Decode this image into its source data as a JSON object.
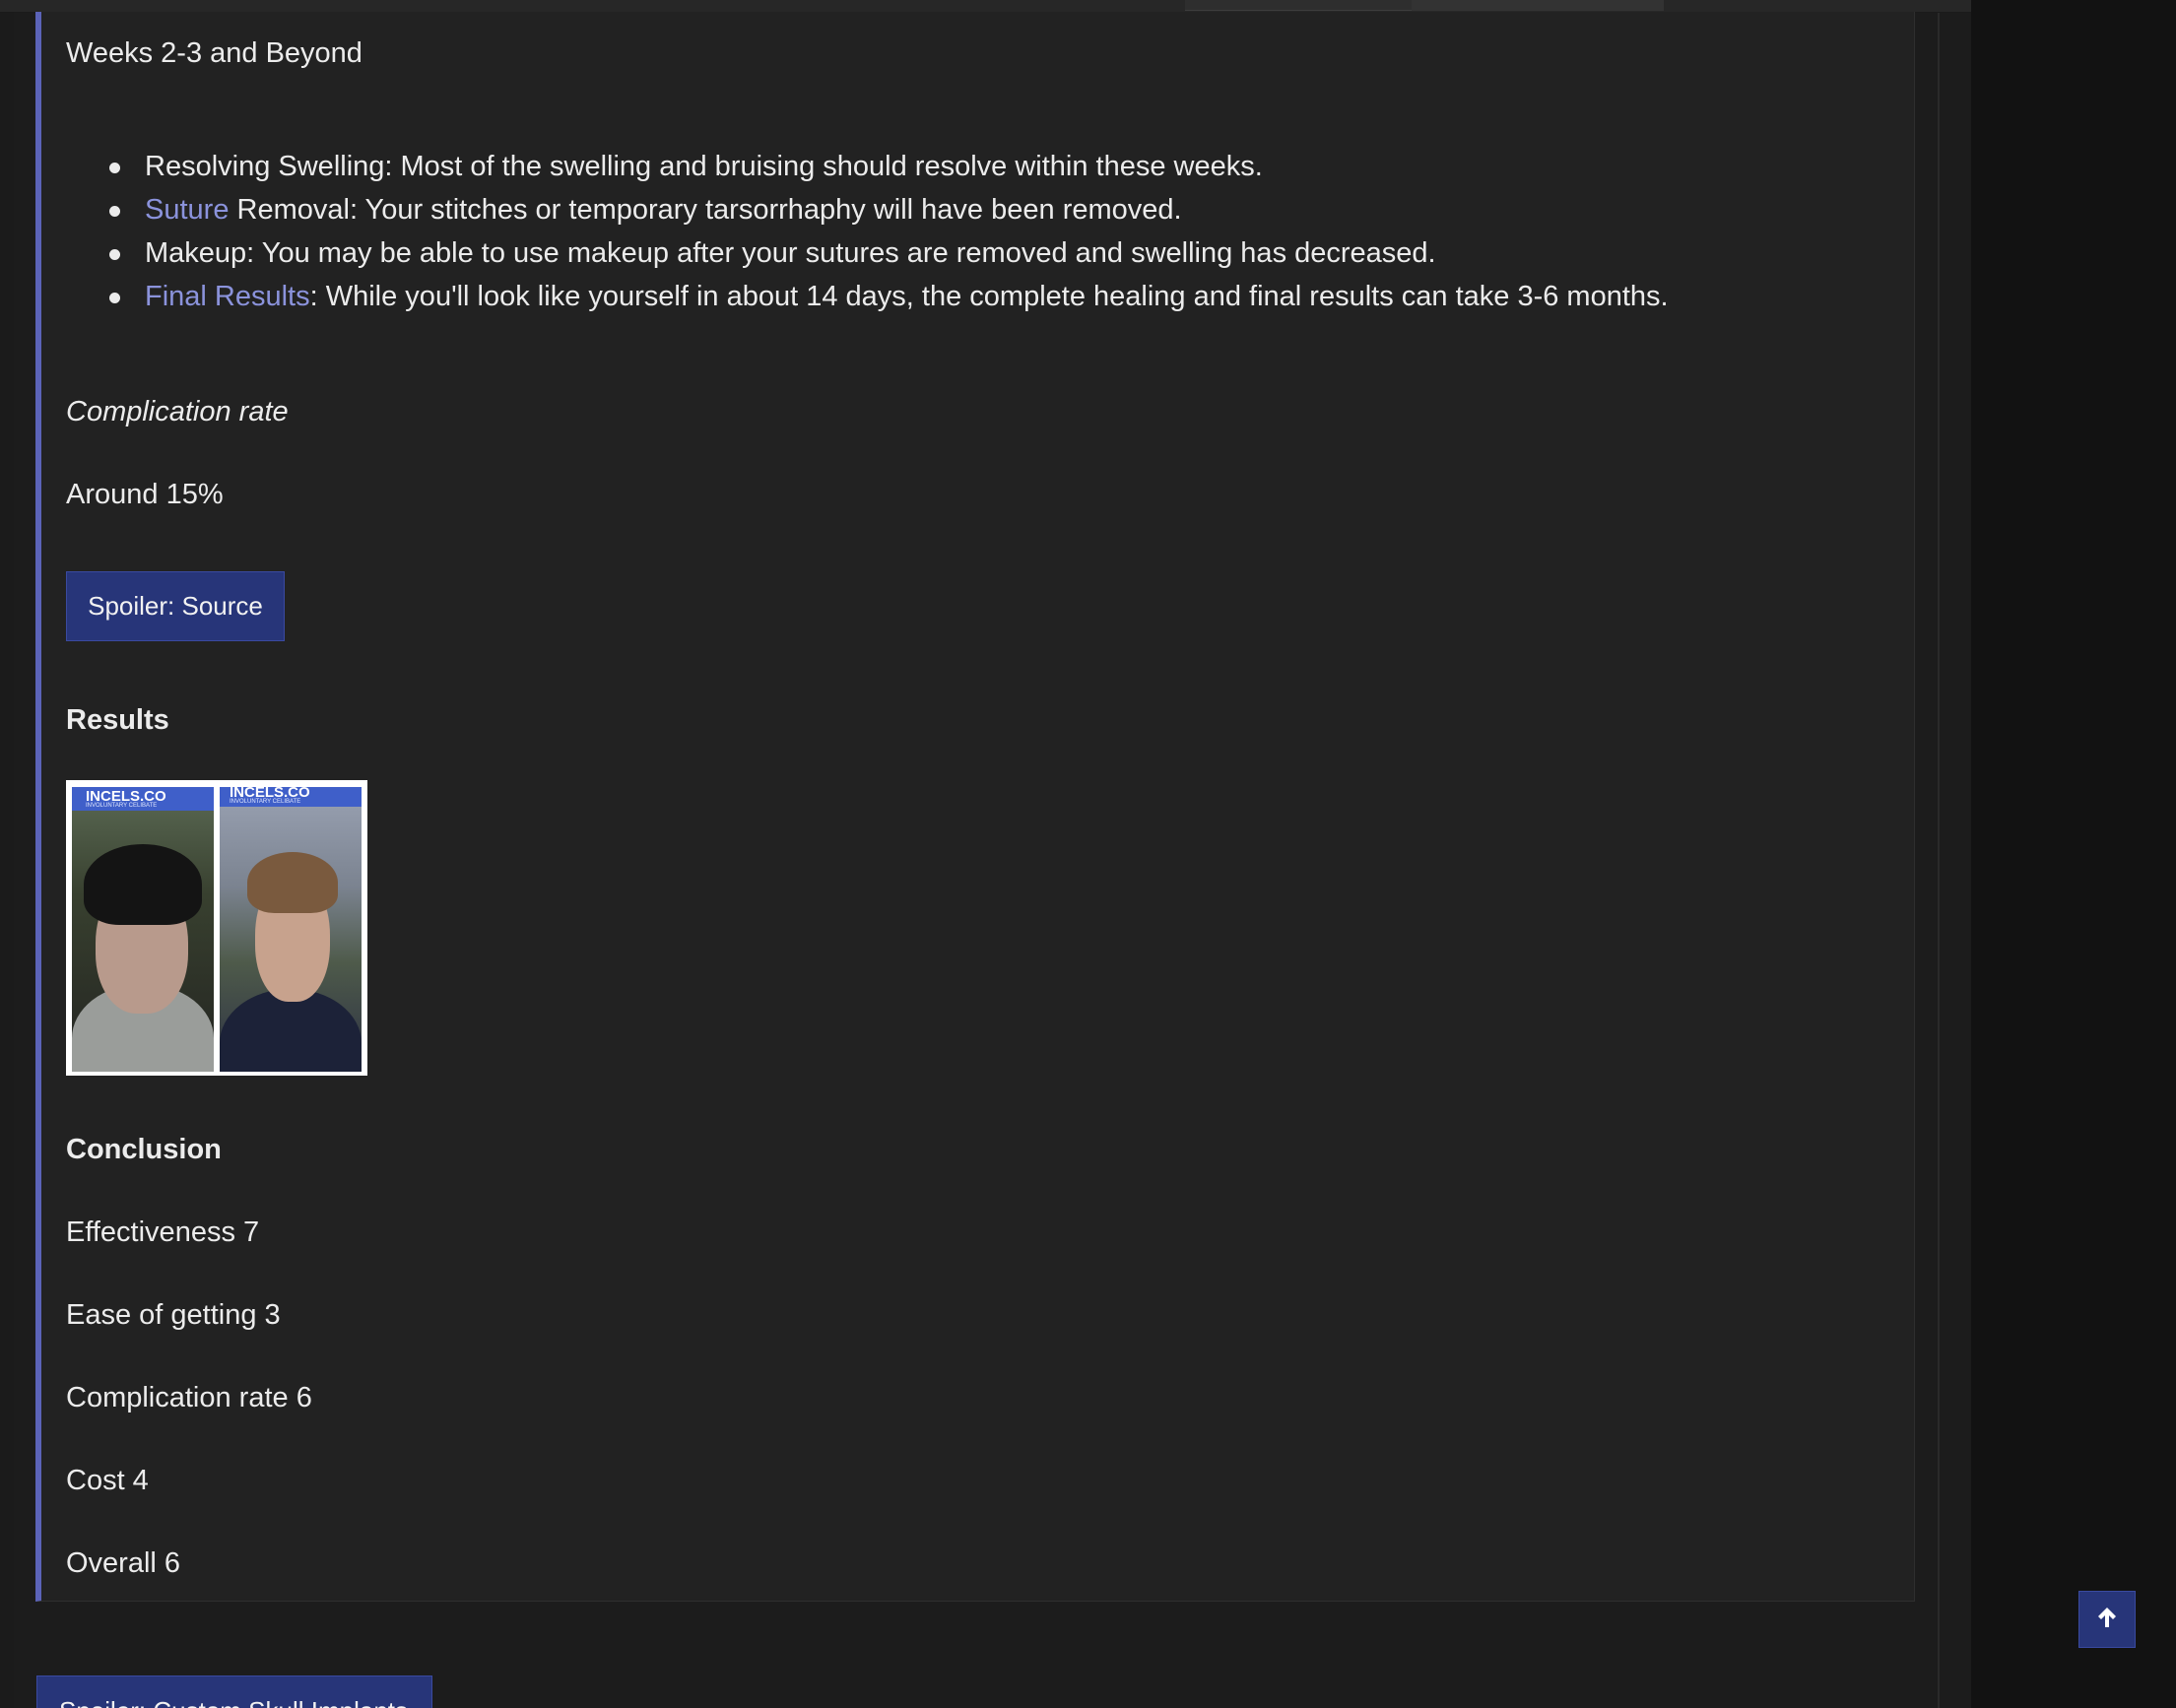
{
  "post": {
    "phase_heading": "Weeks 2-3 and Beyond",
    "bullets": [
      {
        "text": "Resolving Swelling: Most of the swelling and bruising should resolve within these weeks."
      },
      {
        "link": "Suture",
        "text": " Removal: Your stitches or temporary tarsorrhaphy will have been removed."
      },
      {
        "text": "Makeup: You may be able to use makeup after your sutures are removed and swelling has decreased."
      },
      {
        "link": "Final Results",
        "text": ": While you'll look like yourself in about 14 days, the complete healing and final results can take 3-6 months."
      }
    ],
    "complication_heading": "Complication rate",
    "complication_value": "Around 15%",
    "source_spoiler_label": "Spoiler: Source",
    "results_heading": "Results",
    "results_image": {
      "watermark_title": "INCELS.CO",
      "watermark_subtitle": "INVOLUNTARY CELIBATE"
    },
    "conclusion_heading": "Conclusion",
    "ratings": [
      "Effectiveness 7",
      "Ease of getting 3",
      "Complication rate 6",
      "Cost 4",
      "Overall 6"
    ]
  },
  "next_spoiler_label": "Spoiler: Custom Skull Implants",
  "scroll_top": {
    "icon": "arrow-up-icon"
  },
  "colors": {
    "accent": "#5b63b8",
    "link": "#8b93dc",
    "button_bg": "#273579",
    "panel_bg": "#222222"
  }
}
